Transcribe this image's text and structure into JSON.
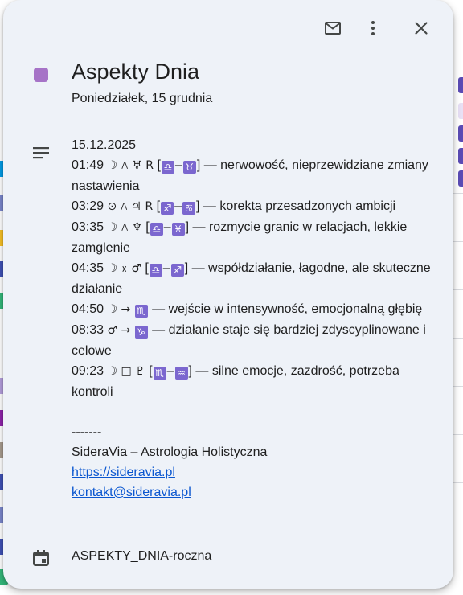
{
  "event": {
    "title": "Aspekty Dnia",
    "date": "Poniedziałek, 15 grudnia",
    "color": "#a673c7"
  },
  "toolbar": {
    "icons": [
      "mail-icon",
      "more-vert-icon",
      "close-icon"
    ]
  },
  "description": {
    "date_line": "15.12.2025",
    "aspects": [
      {
        "time": "01:49",
        "planets": "☽ ⚻ ♅ R",
        "signs": [
          "♎",
          "♉"
        ],
        "text": "— nerwowość, nieprzewidziane zmiany nastawienia"
      },
      {
        "time": "03:29",
        "planets": "⊙ ⚻ ♃ R",
        "signs": [
          "♐",
          "♋"
        ],
        "text": "— korekta przesadzonych ambicji"
      },
      {
        "time": "03:35",
        "planets": "☽ ⚻ ♆",
        "signs": [
          "♎",
          "♓"
        ],
        "text": "— rozmycie granic w relacjach, lekkie zamglenie"
      },
      {
        "time": "04:35",
        "planets": "☽ ⚹ ♂",
        "signs": [
          "♎",
          "♐"
        ],
        "text": "— współdziałanie, łagodne, ale skuteczne działanie"
      },
      {
        "time": "04:50",
        "planets": "☽ →",
        "signs": [
          "♏"
        ],
        "text": "— wejście w intensywność, emocjonalną głębię"
      },
      {
        "time": "08:33",
        "planets": "♂ →",
        "signs": [
          "♑"
        ],
        "text": "— działanie staje się bardziej zdyscyplinowane i celowe"
      },
      {
        "time": "09:23",
        "planets": "☽ □ ♇",
        "signs": [
          "♏",
          "♒"
        ],
        "text": "— silne emocje, zazdrość, potrzeba kontroli"
      }
    ],
    "separator": "-------",
    "signature": "SideraVia – Astrologia Holistyczna",
    "website": "https://sideravia.pl",
    "email": "kontakt@sideravia.pl"
  },
  "calendar": {
    "name": "ASPEKTY_DNIA-roczna"
  }
}
